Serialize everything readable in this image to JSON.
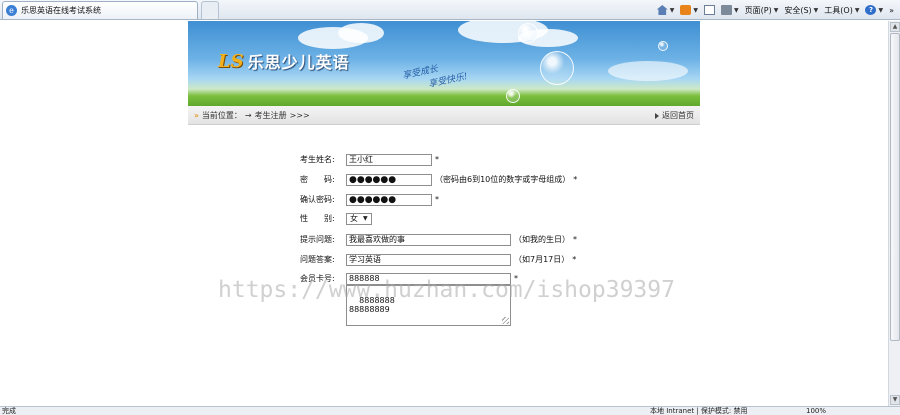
{
  "browser": {
    "tab_title": "乐思英语在线考试系统",
    "menus": [
      "页面(P)",
      "安全(S)",
      "工具(O)"
    ],
    "overflow": "»"
  },
  "banner": {
    "logo_mark": "LS",
    "logo_text": "乐思少儿英语",
    "slogan_1": "享受成长",
    "slogan_2": "享受快乐!"
  },
  "breadcrumb": {
    "prefix": "当前位置：",
    "arrow": "→",
    "current": "考生注册",
    "suffix": ">>>",
    "back_label": "返回首页"
  },
  "form": {
    "name": {
      "label": "考生姓名:",
      "value": "王小红",
      "required": "*"
    },
    "password": {
      "label": "密　　码:",
      "value": "●●●●●●",
      "hint": "（密码由6到10位的数字或字母组成）",
      "required": "*"
    },
    "confirm": {
      "label": "确认密码:",
      "value": "●●●●●●",
      "required": "*"
    },
    "gender": {
      "label": "性　　别:",
      "value": "女"
    },
    "question": {
      "label": "提示问题:",
      "value": "我最喜欢做的事",
      "hint": "（如我的生日）",
      "required": "*"
    },
    "answer": {
      "label": "问题答案:",
      "value": "学习英语",
      "hint": "（如7月17日）",
      "required": "*"
    },
    "card": {
      "label": "会员卡号:",
      "value": "888888",
      "required": "*"
    },
    "card_list": "8888888\n88888889"
  },
  "watermark": "https://www.huzhan.com/ishop39397",
  "statusbar": {
    "left": "完成",
    "zone": "本地 Intranet | 保护模式: 禁用",
    "zoom": "100%"
  }
}
